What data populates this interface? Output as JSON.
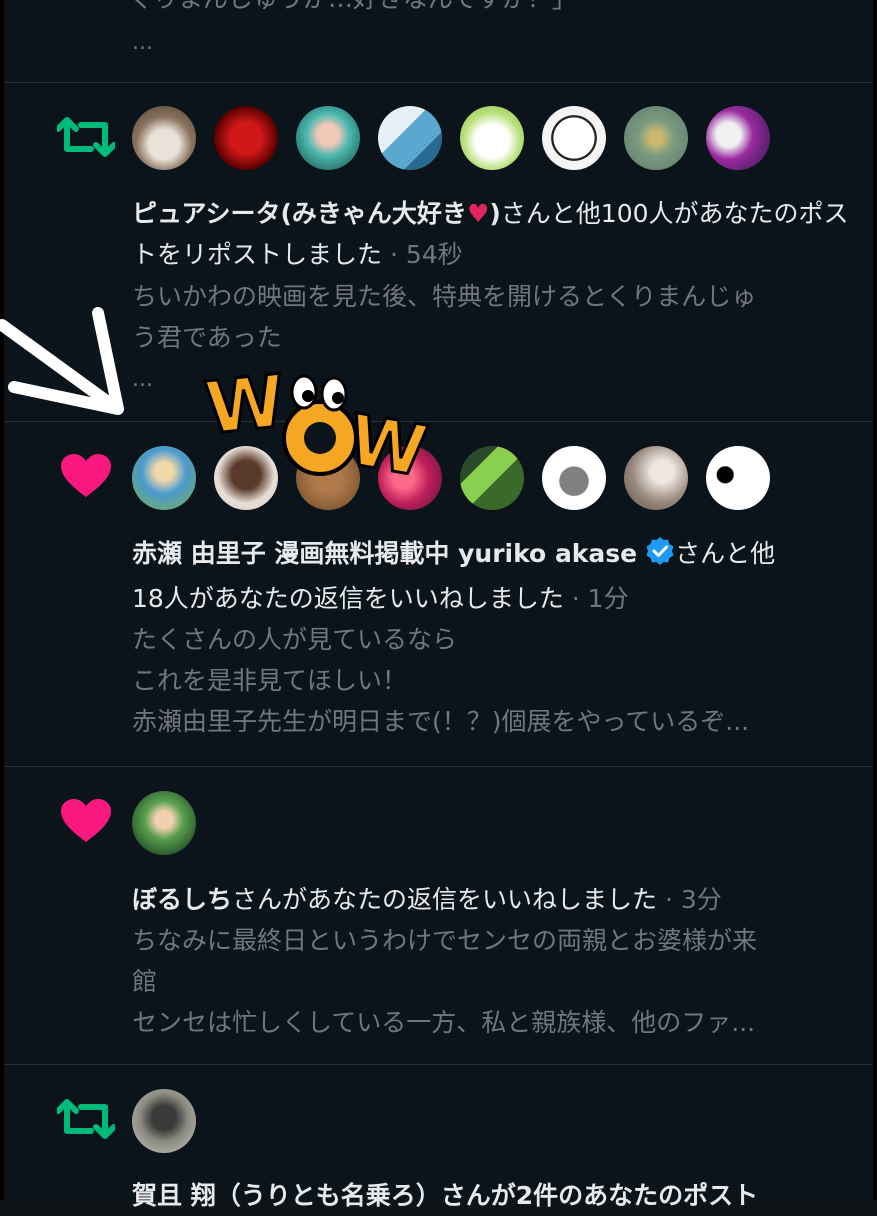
{
  "items": [
    {
      "type": "top-partial",
      "preview_line": "くりまんじゅうが…好きなんですか！」",
      "ellipsis": "..."
    },
    {
      "type": "repost",
      "icon": "repost-icon",
      "name": "ピュアシータ(みきゃん大好き",
      "name_emoji": "♥",
      "name_close": ")",
      "action": "さんと他100人があなたのポストをリポストしました",
      "time": "· 54秒",
      "preview": [
        "ちいかわの映画を見た後、特典を開けるとくりまんじゅ",
        "う君であった"
      ],
      "ellipsis": "..."
    },
    {
      "type": "like",
      "icon": "heart-icon",
      "name": "赤瀬 由里子 漫画無料掲載中 yuriko akase",
      "action_a": "さんと他",
      "action_b": "18人があなたの返信をいいねしました",
      "time": "· 1分",
      "preview": [
        "たくさんの人が見ているなら",
        "これを是非見てほしい！",
        "赤瀬由里子先生が明日まで(！？)個展をやっているぞ..."
      ]
    },
    {
      "type": "like",
      "icon": "heart-icon",
      "name": "ぼるしち",
      "action": "さんがあなたの返信をいいねしました",
      "time": "· 3分",
      "preview": [
        "ちなみに最終日というわけでセンセの両親とお婆様が来",
        "館",
        "センセは忙しくしている一方、私と親族様、他のファ..."
      ]
    },
    {
      "type": "repost",
      "icon": "repost-icon",
      "partial_line": "賀且 翔（うりとも名乗ろ）さんが2件のあなたのポスト"
    }
  ],
  "overlay": {
    "sticker_text": "WOW",
    "arrow": "white-arrow"
  },
  "colors": {
    "background": "#0b131b",
    "divider": "#2a3038",
    "text": "#e7e9ea",
    "muted": "#71767b",
    "repost_green": "#00ba7c",
    "like_pink": "#f91880",
    "verified_blue": "#1d9bf0",
    "sticker_orange": "#f5a623"
  }
}
